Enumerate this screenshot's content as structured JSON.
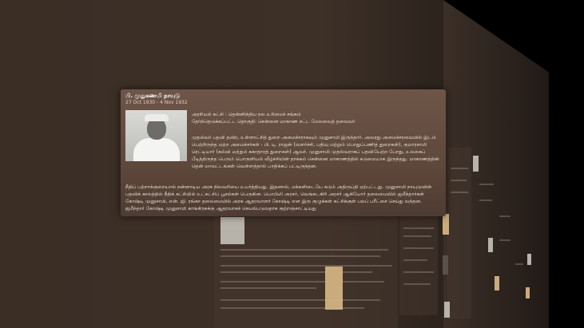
{
  "panel": {
    "name": "பி. முதுகணமி நாயுடு",
    "dates": "27 Oct 1930 - 4 Nov 1932",
    "party": "அரசியல் கட்சி : தென்னிந்திய நல உரிமைச் சங்கம்",
    "constituency": "தேர்ந்தெடுக்கப்பட்ட தொகுதி: சென்னை மாகாண சட்ட மேலவைத் தலைவர்",
    "para1": "முதல்வர் பதவி தவிர, உள்ளாட்சித் துறை அமைச்சராகவும் முனுசாமி இருந்தார். அவரது அமைச்சரவையில் இடம் பெற்றிருந்த மற்ற அமைச்சர்கள் - பி. டி. ராஜன் (வளர்ச்சி, பதிவு மற்றும் பொதுப்பணித் துறைகள்), குமாரசாமி ரெட்டியார் (கல்வி மற்றும் சுகாதாரத் துறைகள்) ஆவர். முனுசாமி முதல்வராகப் பதவியேற்ற போது, உலகைப் பீடித்திருந்த பெரும் பொருளியல் வீழ்ச்சியின் தாக்கம் சென்னை மாகாணத்தில் கடுமையாக இருந்தது. மாகாணத்தின் தென் மாவட்டங்கள் வெள்ளத்தால் பாதிக்கப் பட்டிருந்தன.",
    "para2": "நீதிப் பற்றாக்குறையால் நன்னாடிய அரசு நிலவரியை உயர்த்தியது. இதனால், மக்களிடையே கடும் அதிருப்தி ஏற்பட்டது. முனுசாமி நாயுடுவின் பதவிக் காலத்தில் நீதிக் கட்சியில் உட்கட்சிப் பூசல்கள் பெருகின. பொபிலி அரசர், வெங்கடகிரி அரசர் ஆகியோர் தலைமையில் ஜமீந்தார்கள் கோஷ்டி முனுசாமி, என். ஜி. ரங்கா தலைமையில் அரசு ஆதரவாளர் கோஷ்டி என இரு குழுக்கள் கட்சிக்குள் பலப் பரீட்சை செய்து வந்தன. ஜமீந்தார் கோஷ்டி முனுசாமி காங்கிரசுக்கு ஆதரவாகச் செயல்படுவதாக குற்றஞ்சாட்டியது"
  }
}
